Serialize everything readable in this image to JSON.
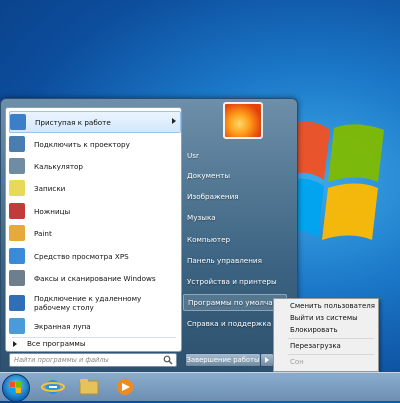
{
  "start_menu": {
    "programs": [
      {
        "label": "Приступая к работе",
        "icon": "getting-started-icon",
        "color": "#3c7fc9",
        "submenu": true
      },
      {
        "label": "Подключить к проектору",
        "icon": "projector-icon",
        "color": "#4a7db0"
      },
      {
        "label": "Калькулятор",
        "icon": "calculator-icon",
        "color": "#6f8ca5"
      },
      {
        "label": "Записки",
        "icon": "sticky-notes-icon",
        "color": "#e8d95a"
      },
      {
        "label": "Ножницы",
        "icon": "scissors-icon",
        "color": "#c23b3b"
      },
      {
        "label": "Paint",
        "icon": "paint-icon",
        "color": "#e6a93b"
      },
      {
        "label": "Средство просмотра XPS",
        "icon": "xps-viewer-icon",
        "color": "#3a8ad8"
      },
      {
        "label": "Факсы и сканирование Windows",
        "icon": "fax-scan-icon",
        "color": "#6d7e8d"
      },
      {
        "label": "Подключение к удаленному рабочему столу",
        "icon": "remote-desktop-icon",
        "color": "#2f6fb8"
      },
      {
        "label": "Экранная лупа",
        "icon": "magnifier-icon",
        "color": "#4b9bd9"
      }
    ],
    "all_programs": "Все программы",
    "search_placeholder": "Найти программы и файлы",
    "user_name": "Usr",
    "right_items": [
      "Документы",
      "Изображения",
      "Музыка",
      "Компьютер",
      "Панель управления",
      "Устройства и принтеры",
      "Программы по умолчани",
      "Справка и поддержка"
    ],
    "shutdown_label": "Завершение работы"
  },
  "context_menu": {
    "items": [
      "Сменить пользователя",
      "Выйти из системы",
      "Блокировать",
      "Перезагрузка",
      "Сон"
    ],
    "disabled": "Сон"
  },
  "taskbar": {
    "buttons": [
      "internet-explorer-icon",
      "explorer-folder-icon",
      "media-player-icon"
    ]
  },
  "colors": {
    "accent": "#1b78c8"
  }
}
